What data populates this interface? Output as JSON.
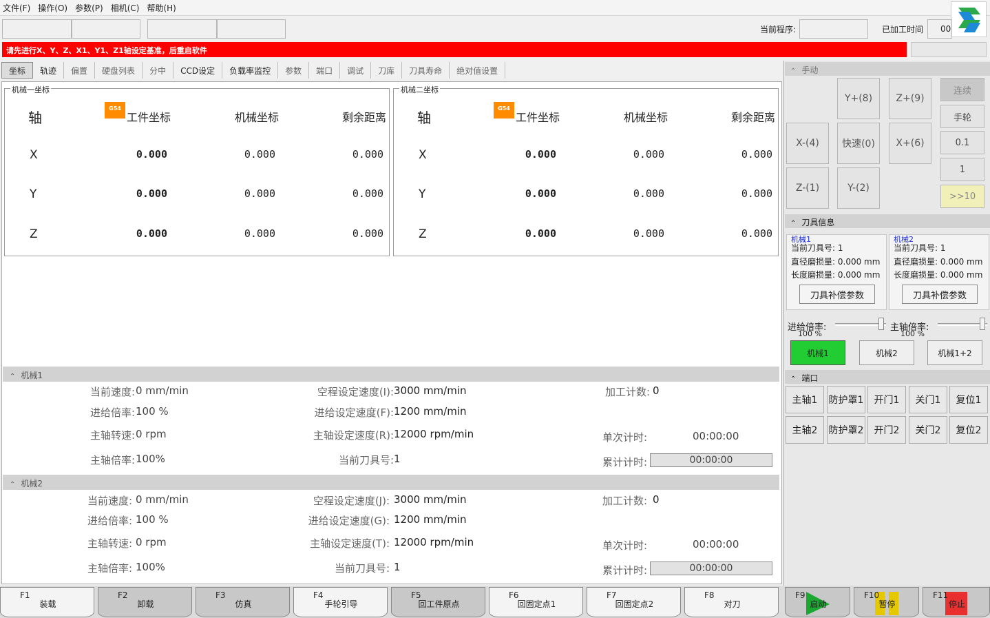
{
  "menu": [
    "文件(F)",
    "操作(O)",
    "参数(P)",
    "相机(C)",
    "帮助(H)"
  ],
  "status": {
    "current_program_label": "当前程序:",
    "elapsed_label": "已加工时间",
    "elapsed_value": "00:"
  },
  "alarm": "请先进行X、Y、Z、X1、Y1、Z1轴设定基准，后重启软件",
  "tabs": [
    "坐标",
    "轨迹",
    "偏置",
    "硬盘列表",
    "分中",
    "CCD设定",
    "负载率监控",
    "参数",
    "端口",
    "调试",
    "刀库",
    "刀具寿命",
    "绝对值设置"
  ],
  "coords": {
    "headers": {
      "axis": "轴",
      "work": "工件坐标",
      "machine": "机械坐标",
      "remain": "剩余距离",
      "g54": "G54"
    },
    "panels": [
      {
        "title": "机械一坐标",
        "rows": [
          {
            "axis": "X",
            "work": "0.000",
            "machine": "0.000",
            "remain": "0.000"
          },
          {
            "axis": "Y",
            "work": "0.000",
            "machine": "0.000",
            "remain": "0.000"
          },
          {
            "axis": "Z",
            "work": "0.000",
            "machine": "0.000",
            "remain": "0.000"
          }
        ]
      },
      {
        "title": "机械二坐标",
        "rows": [
          {
            "axis": "X",
            "work": "0.000",
            "machine": "0.000",
            "remain": "0.000"
          },
          {
            "axis": "Y",
            "work": "0.000",
            "machine": "0.000",
            "remain": "0.000"
          },
          {
            "axis": "Z",
            "work": "0.000",
            "machine": "0.000",
            "remain": "0.000"
          }
        ]
      }
    ]
  },
  "machine1": {
    "title": "机械1",
    "cur_speed_label": "当前速度:",
    "cur_speed": "0 mm/min",
    "feed_rate_label": "进给倍率:",
    "feed_rate": "100 %",
    "spindle_speed_label": "主轴转速:",
    "spindle_speed": "0 rpm",
    "spindle_rate_label": "主轴倍率:",
    "spindle_rate": "100%",
    "rapid_set_label": "空程设定速度(I):",
    "rapid_set": "3000 mm/min",
    "feed_set_label": "进给设定速度(F):",
    "feed_set": "1200 mm/min",
    "spindle_set_label": "主轴设定速度(R):",
    "spindle_set": "12000 rpm/min",
    "tool_label": "当前刀具号:",
    "tool": "1",
    "count_label": "加工计数:",
    "count": "0",
    "single_timer_label": "单次计时:",
    "single_timer": "00:00:00",
    "total_timer_label": "累计计时:",
    "total_timer": "00:00:00"
  },
  "machine2": {
    "title": "机械2",
    "cur_speed_label": "当前速度:",
    "cur_speed": "0 mm/min",
    "feed_rate_label": "进给倍率:",
    "feed_rate": "100 %",
    "spindle_speed_label": "主轴转速:",
    "spindle_speed": "0 rpm",
    "spindle_rate_label": "主轴倍率:",
    "spindle_rate": "100%",
    "rapid_set_label": "空程设定速度(J):",
    "rapid_set": "3000 mm/min",
    "feed_set_label": "进给设定速度(G):",
    "feed_set": "1200 mm/min",
    "spindle_set_label": "主轴设定速度(T):",
    "spindle_set": "12000 rpm/min",
    "tool_label": "当前刀具号:",
    "tool": "1",
    "count_label": "加工计数:",
    "count": "0",
    "single_timer_label": "单次计时:",
    "single_timer": "00:00:00",
    "total_timer_label": "累计计时:",
    "total_timer": "00:00:00"
  },
  "manual": {
    "title": "手动",
    "y_plus": "Y+(8)",
    "z_plus": "Z+(9)",
    "x_minus": "X-(4)",
    "rapid": "快速(0)",
    "x_plus": "X+(6)",
    "z_minus": "Z-(1)",
    "y_minus": "Y-(2)",
    "modes": [
      "连续",
      "手轮",
      "0.1",
      "1",
      ">>10"
    ]
  },
  "tool_info": {
    "title": "刀具信息",
    "cur_tool_label": "当前刀具号:",
    "dia_label": "直径磨损量:",
    "len_label": "长度磨损量:",
    "button": "刀具补偿参数",
    "m1": {
      "title": "机械1",
      "cur_tool": "1",
      "dia": "0.000 mm",
      "len": "0.000 mm"
    },
    "m2": {
      "title": "机械2",
      "cur_tool": "1",
      "dia": "0.000 mm",
      "len": "0.000 mm"
    }
  },
  "rates": {
    "feed_label": "进给倍率:",
    "feed_value": "100 %",
    "feed_fraction": 0.9,
    "spindle_label": "主轴倍率:",
    "spindle_value": "100 %",
    "spindle_fraction": 0.9
  },
  "machine_select": [
    "机械1",
    "机械2",
    "机械1+2"
  ],
  "ports": {
    "title": "端口",
    "row1": [
      "主轴1",
      "防护罩1",
      "开门1",
      "关门1",
      "复位1"
    ],
    "row2": [
      "主轴2",
      "防护罩2",
      "开门2",
      "关门2",
      "复位2"
    ]
  },
  "fkeys": [
    {
      "key": "F1",
      "label": "装载"
    },
    {
      "key": "F2",
      "label": "卸载"
    },
    {
      "key": "F3",
      "label": "仿真"
    },
    {
      "key": "F4",
      "label": "手轮引导"
    },
    {
      "key": "F5",
      "label": "回工件原点"
    },
    {
      "key": "F6",
      "label": "回固定点1"
    },
    {
      "key": "F7",
      "label": "回固定点2"
    },
    {
      "key": "F8",
      "label": "对刀"
    },
    {
      "key": "F9",
      "label": "启动"
    },
    {
      "key": "F10",
      "label": "暂停"
    },
    {
      "key": "F11",
      "label": "停止"
    }
  ],
  "colors": {
    "alarm": "#ff0000",
    "g54": "#ff8c00",
    "selected": "#22cc33",
    "start": "#1aa830",
    "pause": "#e6c800",
    "stop": "#e83030"
  }
}
